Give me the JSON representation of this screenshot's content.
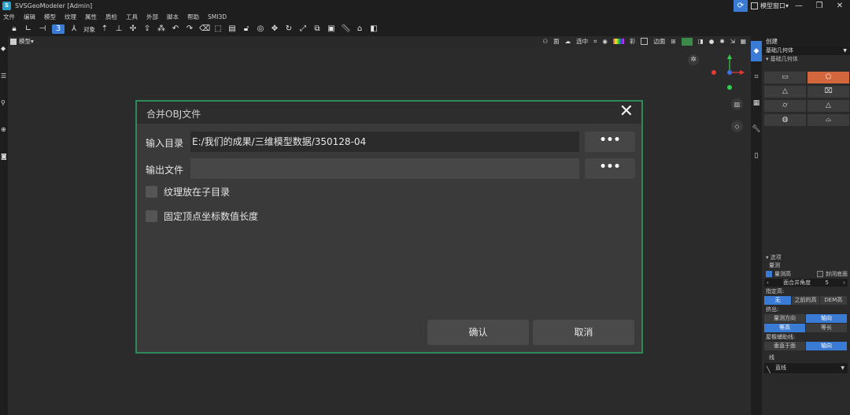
{
  "app": {
    "title": "SVSGeoModeler [Admin]",
    "logo_text": "S"
  },
  "titlebar": {
    "mode_label": "模型窗口",
    "minimize": "—",
    "maximize": "❐",
    "close": "✕"
  },
  "menu": [
    "文件",
    "编辑",
    "模型",
    "纹理",
    "属性",
    "质检",
    "工具",
    "外部",
    "脚本",
    "帮助",
    "SMI3D"
  ],
  "toolbar": {
    "object_label": "对象"
  },
  "viewport": {
    "mode_label": "模型",
    "tools": {
      "display": "面",
      "center": "选中",
      "color": "彩",
      "face": "边面"
    }
  },
  "right_panel": {
    "header": "创建",
    "type_select": "基础几何体",
    "section": "基础几何体",
    "options_title": "选项",
    "measure_label": "量测",
    "cb_measure_height": "量测高",
    "cb_close_bottom": "封闭底面",
    "merge_angle_label": "面合并角度",
    "merge_angle_value": "5",
    "fixed_height_label": "指定高:",
    "fixed_height_opts": [
      "无",
      "之前的高",
      "DEM高"
    ],
    "extrude_label": "挤出:",
    "extrude_opts": [
      "量测方向",
      "轴向"
    ],
    "extrude_opts2": [
      "等高",
      "等长"
    ],
    "roof_label": "屋檐辅助线:",
    "roof_opts": [
      "垂直于面",
      "轴向"
    ],
    "line_label": "线",
    "line_value": "直线"
  },
  "dialog": {
    "title": "合并OBJ文件",
    "input_dir_label": "输入目录",
    "input_dir_value": "E:/我们的成果/三维模型数据/350128-04",
    "output_file_label": "输出文件",
    "output_file_value": "",
    "browse_label": "•••",
    "cb_texture_subdir": "纹理放在子目录",
    "cb_fixed_vertex": "固定顶点坐标数值长度",
    "ok_label": "确认",
    "cancel_label": "取消"
  }
}
